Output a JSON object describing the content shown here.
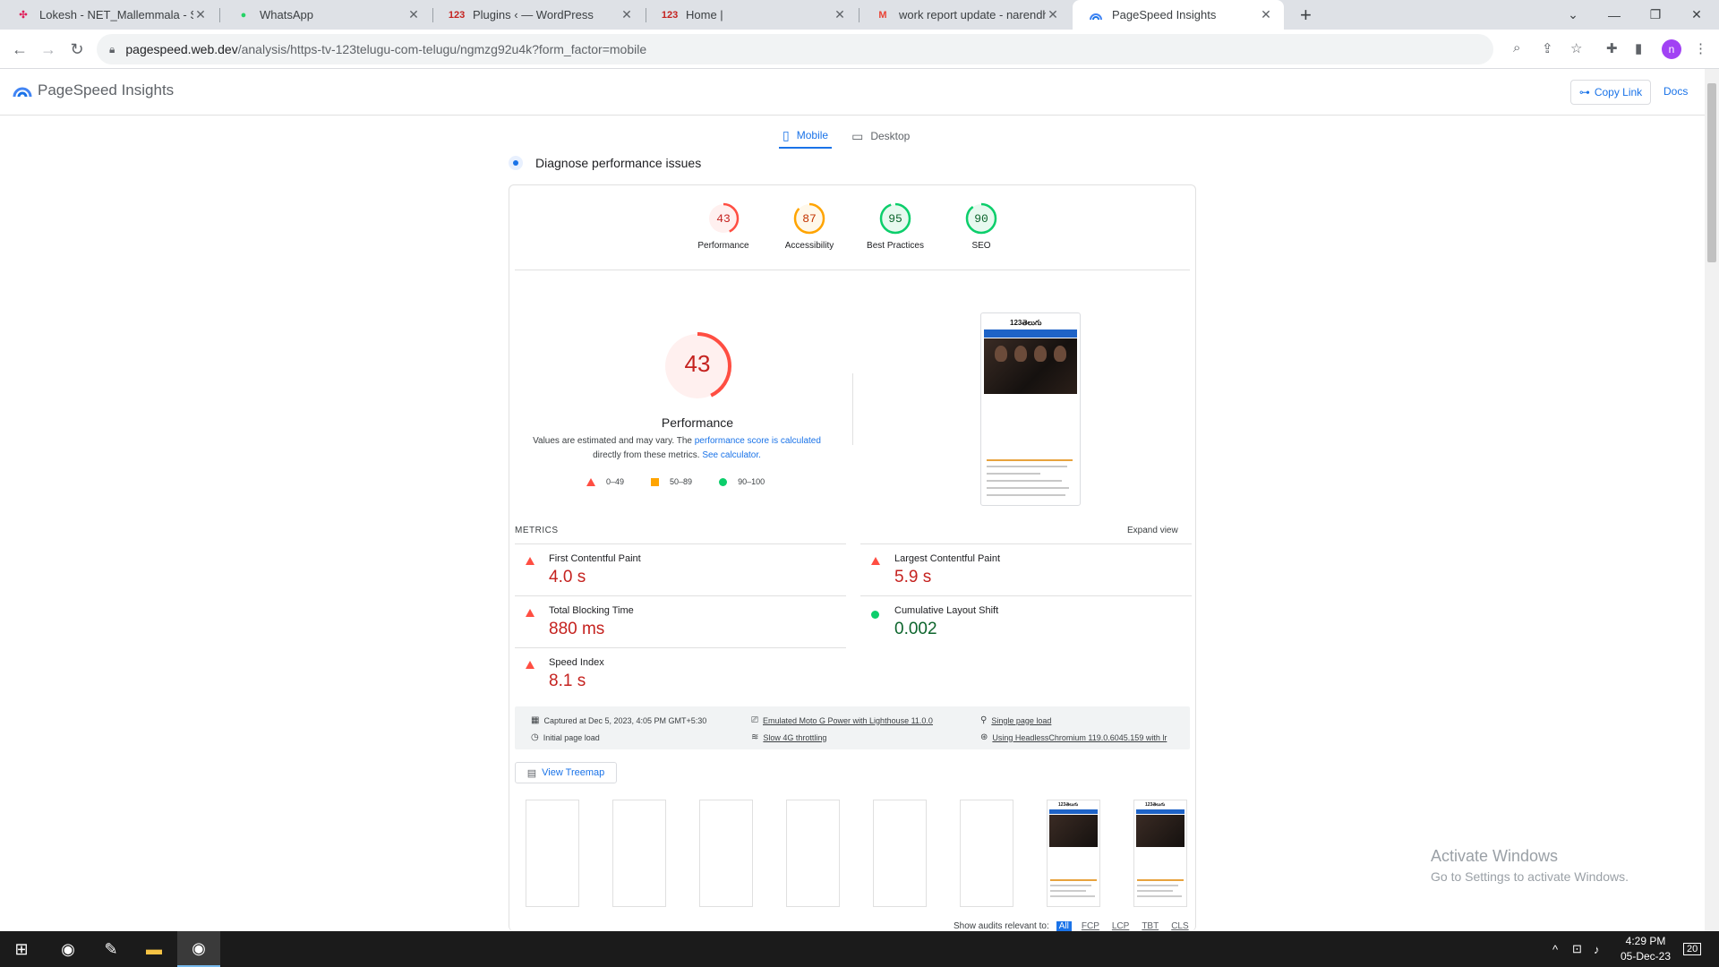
{
  "browser": {
    "tabs": [
      {
        "title": "Lokesh - NET_Mallemmala - Sla",
        "icon": "slack-icon"
      },
      {
        "title": "WhatsApp",
        "icon": "whatsapp-icon"
      },
      {
        "title": "Plugins ‹ — WordPress",
        "icon": "123-icon"
      },
      {
        "title": "Home |",
        "icon": "123-icon"
      },
      {
        "title": "work report update - narendhar",
        "icon": "gmail-icon"
      },
      {
        "title": "PageSpeed Insights",
        "icon": "pagespeed-icon"
      }
    ],
    "new_tab_label": "+",
    "url_host": "pagespeed.web.dev",
    "url_path": "/analysis/https-tv-123telugu-com-telugu/ngmzg92u4k?form_factor=mobile",
    "profile_initial": "n"
  },
  "header": {
    "app_name": "PageSpeed Insights",
    "copy_link": "Copy Link",
    "docs": "Docs"
  },
  "device_tabs": [
    {
      "label": "Mobile",
      "active": true
    },
    {
      "label": "Desktop",
      "active": false
    }
  ],
  "diagnose_title": "Diagnose performance issues",
  "category_scores": [
    {
      "label": "Performance",
      "score": 43,
      "color": "#c5221f",
      "ring": "#ff4e42",
      "bg": "#fff0ef"
    },
    {
      "label": "Accessibility",
      "score": 87,
      "color": "#c33300",
      "ring": "#ffa400",
      "bg": "#fff8ea"
    },
    {
      "label": "Best Practices",
      "score": 95,
      "color": "#0d652d",
      "ring": "#0cce6b",
      "bg": "#e7f9ef"
    },
    {
      "label": "SEO",
      "score": 90,
      "color": "#0d652d",
      "ring": "#0cce6b",
      "bg": "#e7f9ef"
    }
  ],
  "performance": {
    "score": "43",
    "score_value": 43,
    "title": "Performance",
    "note_prefix": "Values are estimated and may vary. The ",
    "note_link1": "performance score is calculated",
    "note_mid": " directly from these metrics. ",
    "note_link2": "See calculator.",
    "legend": [
      "0–49",
      "50–89",
      "90–100"
    ]
  },
  "screenshot": {
    "site_logo": "123తెలుగు"
  },
  "metrics": {
    "section_label": "METRICS",
    "expand_label": "Expand view",
    "items": [
      {
        "name": "First Contentful Paint",
        "value": "4.0 s",
        "status": "red"
      },
      {
        "name": "Largest Contentful Paint",
        "value": "5.9 s",
        "status": "red"
      },
      {
        "name": "Total Blocking Time",
        "value": "880 ms",
        "status": "red"
      },
      {
        "name": "Cumulative Layout Shift",
        "value": "0.002",
        "status": "green"
      },
      {
        "name": "Speed Index",
        "value": "8.1 s",
        "status": "red"
      }
    ]
  },
  "run_info": {
    "captured": "Captured at Dec 5, 2023, 4:05 PM GMT+5:30",
    "initial_load": "Initial page load",
    "emulated": "Emulated Moto G Power with Lighthouse 11.0.0",
    "throttling": "Slow 4G throttling",
    "single_load": "Single page load",
    "chromium": "Using HeadlessChromium 119.0.6045.159 with lr"
  },
  "view_treemap": "View Treemap",
  "audits": {
    "label": "Show audits relevant to:",
    "filters": [
      "All",
      "FCP",
      "LCP",
      "TBT",
      "CLS"
    ]
  },
  "watermark": {
    "line1": "Activate Windows",
    "line2": "Go to Settings to activate Windows."
  },
  "taskbar": {
    "time": "4:29 PM",
    "date": "05-Dec-23",
    "notif_count": "20"
  }
}
